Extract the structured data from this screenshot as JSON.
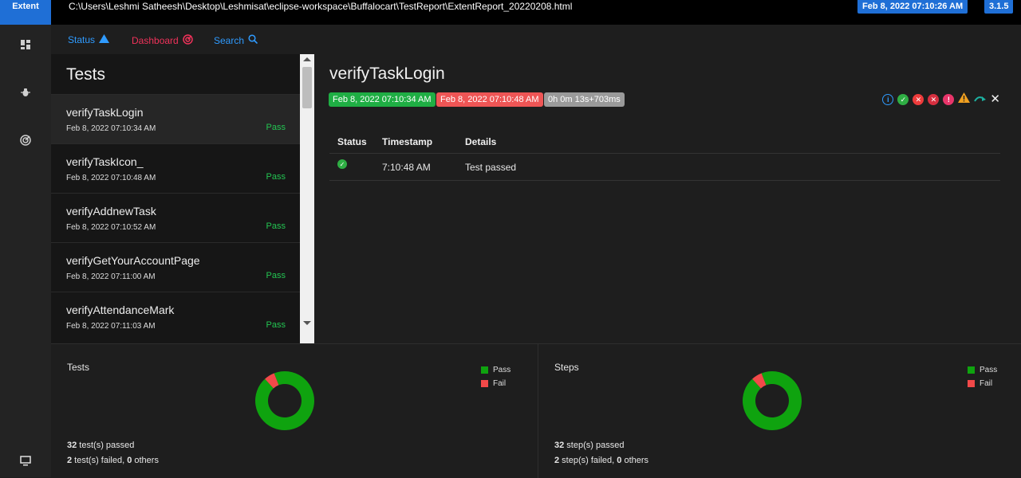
{
  "topbar": {
    "brand": "Extent",
    "path": "C:\\Users\\Leshmi Satheesh\\Desktop\\Leshmisat\\eclipse-workspace\\Buffalocart\\TestReport\\ExtentReport_20220208.html",
    "date": "Feb 8, 2022 07:10:26 AM",
    "version": "3.1.5"
  },
  "sidebar": {
    "icons": [
      "dashboard-grid-icon",
      "bug-icon",
      "radar-icon",
      "monitor-icon"
    ]
  },
  "nav": {
    "status": "Status",
    "dashboard": "Dashboard",
    "search": "Search",
    "colors": {
      "status": "#2f9bff",
      "dashboard": "#f0325a",
      "search": "#2f9bff"
    }
  },
  "tests": {
    "title": "Tests",
    "items": [
      {
        "name": "verifyTaskLogin",
        "time": "Feb 8, 2022 07:10:34 AM",
        "status": "Pass"
      },
      {
        "name": "verifyTaskIcon_",
        "time": "Feb 8, 2022 07:10:48 AM",
        "status": "Pass"
      },
      {
        "name": "verifyAddnewTask",
        "time": "Feb 8, 2022 07:10:52 AM",
        "status": "Pass"
      },
      {
        "name": "verifyGetYourAccountPage",
        "time": "Feb 8, 2022 07:11:00 AM",
        "status": "Pass"
      },
      {
        "name": "verifyAttendanceMark",
        "time": "Feb 8, 2022 07:11:03 AM",
        "status": "Pass"
      }
    ]
  },
  "detail": {
    "title": "verifyTaskLogin",
    "start": "Feb 8, 2022 07:10:34 AM",
    "end": "Feb 8, 2022 07:10:48 AM",
    "duration": "0h 0m 13s+703ms",
    "columns": {
      "status": "Status",
      "timestamp": "Timestamp",
      "details": "Details"
    },
    "rows": [
      {
        "status_icon": "check-circle-icon",
        "timestamp": "7:10:48 AM",
        "details": "Test passed"
      }
    ]
  },
  "summary": {
    "tests": {
      "title": "Tests",
      "legend_pass": "Pass",
      "legend_fail": "Fail",
      "passed_count": "32",
      "passed_text": " test(s) passed",
      "failed_count": "2",
      "failed_text": " test(s) failed, ",
      "others_count": "0",
      "others_text": " others",
      "chart_data": {
        "type": "pie",
        "categories": [
          "Pass",
          "Fail"
        ],
        "values": [
          32,
          2
        ]
      }
    },
    "steps": {
      "title": "Steps",
      "legend_pass": "Pass",
      "legend_fail": "Fail",
      "passed_count": "32",
      "passed_text": " step(s) passed",
      "failed_count": "2",
      "failed_text": " step(s) failed, ",
      "others_count": "0",
      "others_text": " others",
      "chart_data": {
        "type": "pie",
        "categories": [
          "Pass",
          "Fail"
        ],
        "values": [
          32,
          2
        ]
      }
    },
    "colors": {
      "pass": "#0fa30f",
      "fail": "#f24949"
    }
  }
}
